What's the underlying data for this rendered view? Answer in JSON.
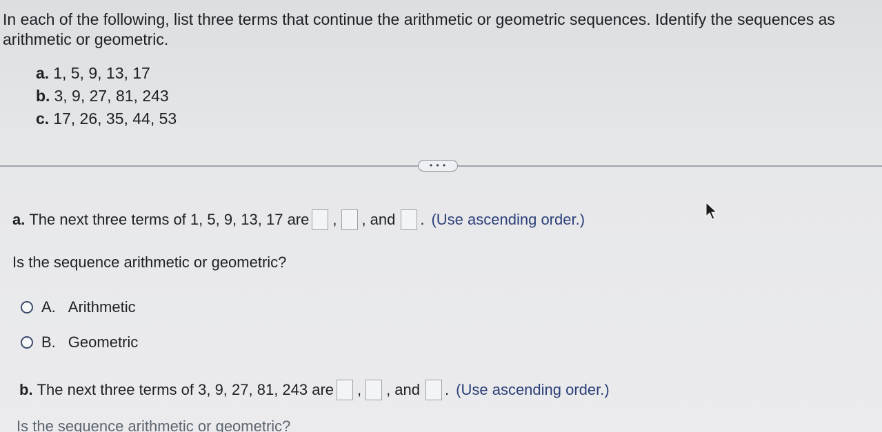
{
  "instructions": {
    "line1": "In each of the following, list three terms that continue the arithmetic or geometric sequences. Identify the sequences as",
    "line2": "arithmetic or geometric."
  },
  "parts": [
    {
      "letter": "a.",
      "sequence": "1, 5, 9, 13, 17"
    },
    {
      "letter": "b.",
      "sequence": "3, 9, 27, 81, 243"
    },
    {
      "letter": "c.",
      "sequence": "17, 26, 35, 44, 53"
    }
  ],
  "more_button": "• • •",
  "part_a": {
    "letter": "a.",
    "text": "The next three terms of 1, 5, 9, 13, 17 are",
    "comma": ",",
    "and": "and",
    "period": ".",
    "hint": "(Use ascending order.)"
  },
  "question": "Is the sequence arithmetic or geometric?",
  "options": [
    {
      "letter": "A.",
      "label": "Arithmetic"
    },
    {
      "letter": "B.",
      "label": "Geometric"
    }
  ],
  "part_b": {
    "letter": "b.",
    "text": "The next three terms of 3, 9, 27, 81, 243 are",
    "comma": ",",
    "and": "and",
    "period": ".",
    "hint": "(Use ascending order.)"
  },
  "question_b_partial": "Is the sequence arithmetic or geometric?"
}
